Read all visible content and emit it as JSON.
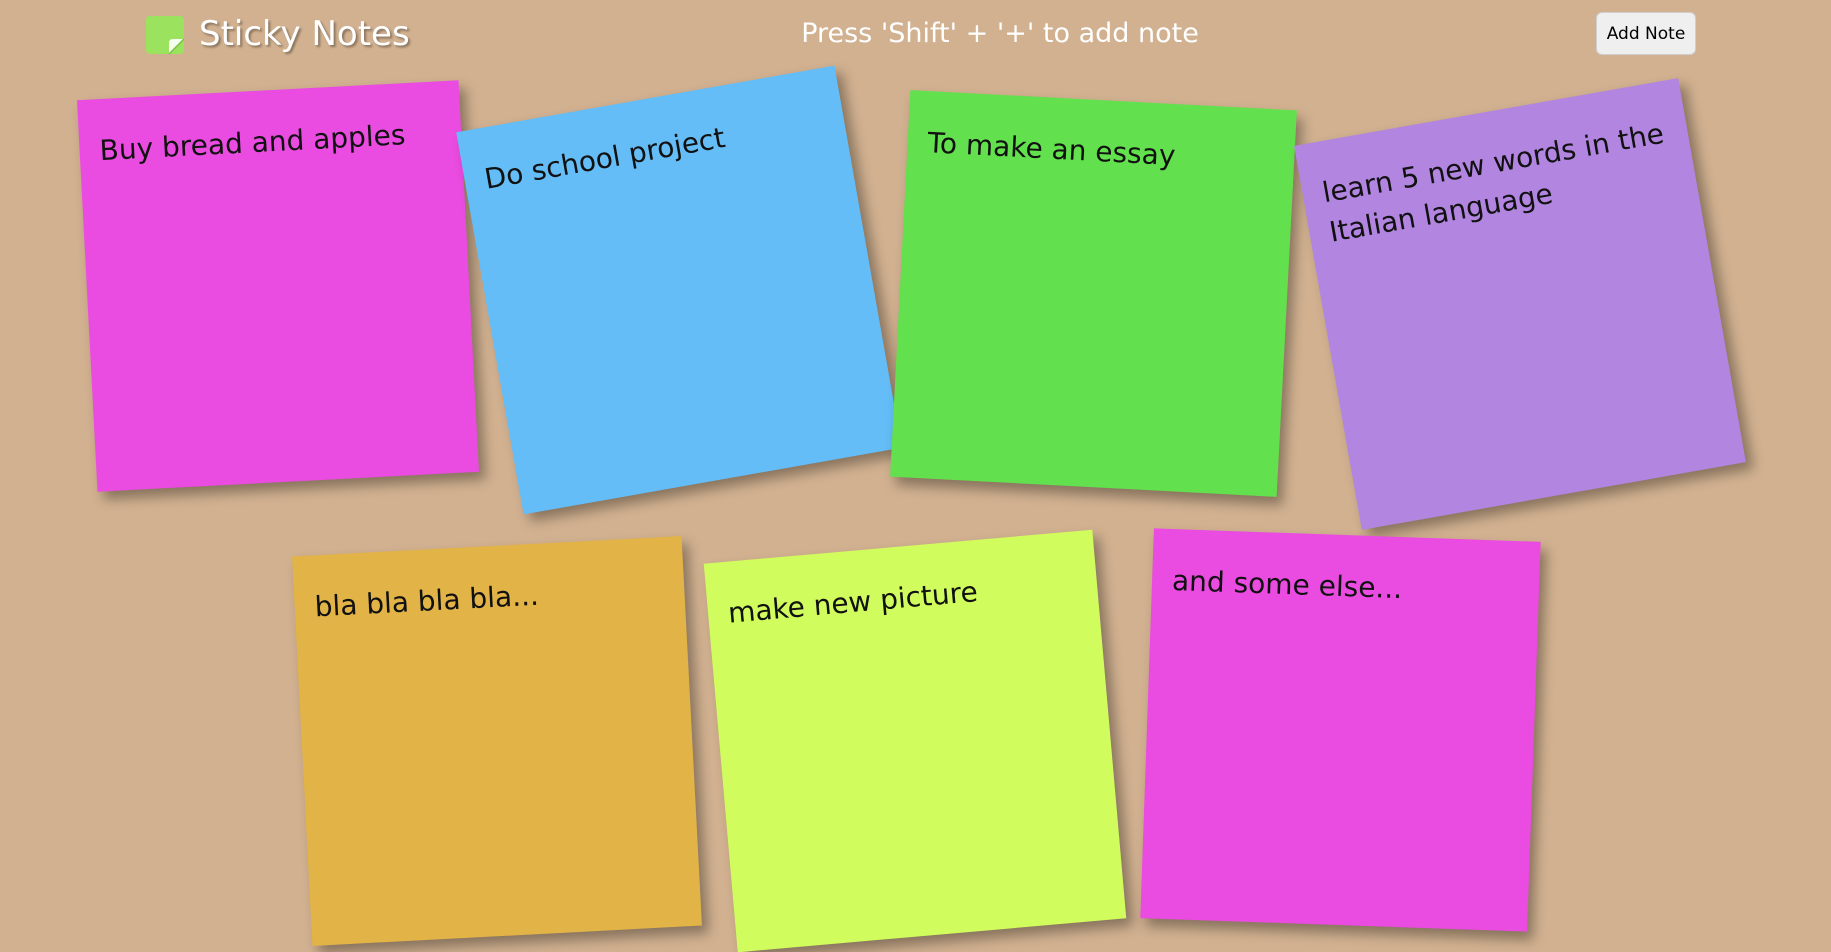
{
  "header": {
    "title": "Sticky Notes",
    "hint": "Press 'Shift' + '+' to add note",
    "add_button_label": "Add Note",
    "logo_icon": "sticky-note-icon",
    "logo_color": "#9be35f"
  },
  "notes": [
    {
      "text": "Buy bread and apples",
      "color": "#ea4be0"
    },
    {
      "text": "Do school project",
      "color": "#64bdf7"
    },
    {
      "text": "To make an essay",
      "color": "#63e04d"
    },
    {
      "text": "learn 5 new words in the Italian language",
      "color": "#b185e0"
    },
    {
      "text": "bla bla bla bla...",
      "color": "#e2b347"
    },
    {
      "text": "make new picture",
      "color": "#d1fc5d"
    },
    {
      "text": "and some else...",
      "color": "#ea4be0"
    }
  ]
}
